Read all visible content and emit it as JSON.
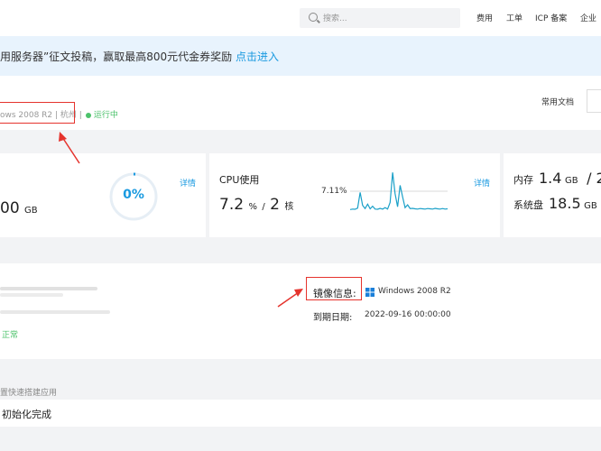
{
  "topbar": {
    "search_placeholder": "搜索...",
    "nav": [
      "费用",
      "工单",
      "ICP 备案",
      "企业"
    ]
  },
  "banner": {
    "text": "用服务器”征文投稿，赢取最高800元代金券奖励 ",
    "link": "点击进入"
  },
  "header": {
    "instance_meta": "ows 2008 R2 | 杭州 |",
    "status": "运行中",
    "doc_link": "常用文档"
  },
  "metrics": {
    "disk": {
      "value": "00",
      "unit": "GB",
      "usage": "0%",
      "usage_fraction": 0.0,
      "detail": "详情"
    },
    "cpu": {
      "title": "CPU使用",
      "value": "7.2",
      "unit": "%",
      "separator": "/",
      "cores": "2",
      "cores_unit": "核",
      "peak_label": "7.11%",
      "detail": "详情"
    },
    "memory": {
      "label": "内存",
      "value": "1.4",
      "unit": "GB",
      "separator": "/ 2"
    },
    "system_disk": {
      "label": "系统盘",
      "value": "18.5",
      "unit": "GB"
    }
  },
  "chart_data": {
    "type": "line",
    "title": "",
    "xlabel": "",
    "ylabel": "",
    "annotations": [
      "7.11%"
    ],
    "ylim": [
      0,
      20
    ],
    "series": [
      {
        "values": [
          2.2,
          2.4,
          2.3,
          2.8,
          9.5,
          4.0,
          2.6,
          4.5,
          2.5,
          3.6,
          2.4,
          2.3,
          2.7,
          2.4,
          3.0,
          2.4,
          5.2,
          18.0,
          9.0,
          3.4,
          12.5,
          7.5,
          3.0,
          4.2,
          2.6,
          2.7,
          2.5,
          2.4,
          2.6,
          2.5,
          2.4,
          2.6,
          2.5,
          2.4,
          2.7,
          2.5,
          2.4,
          2.6,
          2.4,
          2.5
        ]
      }
    ]
  },
  "info": {
    "status": "正常",
    "image_label": "镜像信息:",
    "image_value": "Windows 2008 R2",
    "expire_label": "到期日期:",
    "expire_value": "2022-09-16 00:00:00"
  },
  "apps": {
    "hint": "置快速搭建应用",
    "status": "初始化完成"
  },
  "colors": {
    "accent": "#1a9ae0",
    "success": "#4cc26b",
    "highlight": "#e5332d"
  }
}
